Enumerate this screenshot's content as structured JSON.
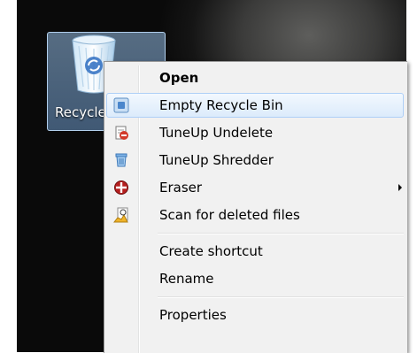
{
  "desktop": {
    "icon": {
      "label": "Recycle",
      "icon_name": "recycle-bin-icon"
    }
  },
  "context_menu": {
    "items": [
      {
        "label": "Open",
        "bold": true,
        "icon": null
      },
      {
        "label": "Empty Recycle Bin",
        "highlighted": true,
        "icon": "empty-recycle-bin-icon"
      },
      {
        "label": "TuneUp Undelete",
        "icon": "tuneup-undelete-icon"
      },
      {
        "label": "TuneUp Shredder",
        "icon": "tuneup-shredder-icon"
      },
      {
        "label": "Eraser",
        "icon": "eraser-icon",
        "has_submenu": true
      },
      {
        "label": "Scan for deleted files",
        "icon": "scan-deleted-files-icon"
      },
      {
        "label": "Create shortcut",
        "icon": null
      },
      {
        "label": "Rename",
        "icon": null
      },
      {
        "label": "Properties",
        "icon": null
      }
    ]
  },
  "colors": {
    "menu_bg": "#f1f1f1",
    "highlight_bg": "#dcebfb",
    "highlight_border": "#aecff7"
  }
}
